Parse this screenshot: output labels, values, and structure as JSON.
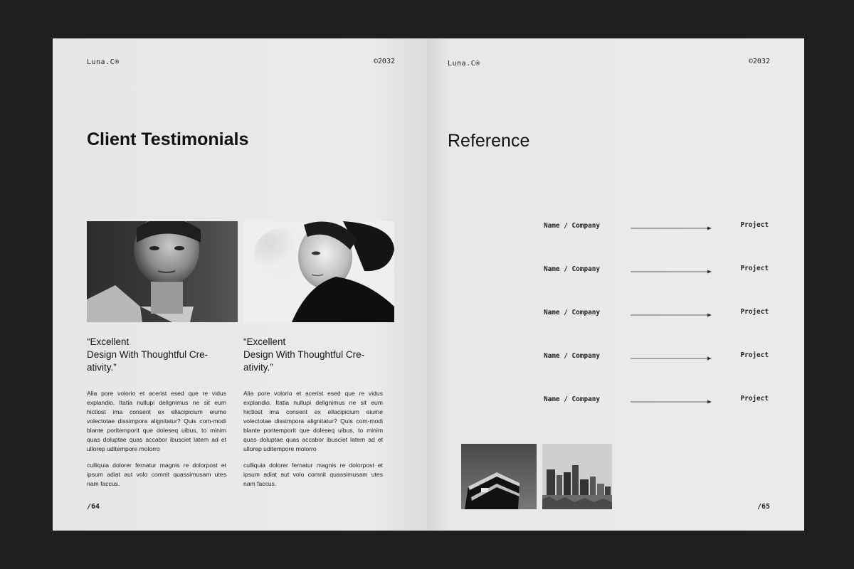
{
  "left_page": {
    "brand": "Luna.C®",
    "year": "©2032",
    "title": "Client Testimonials",
    "testimonials": [
      {
        "quote": "“Excellent\nDesign With Thoughtful Cre-\nativity.”",
        "body1": "Alia pore volorio et acerist esed que re vidus explandio. Itatia nullupi delignimus ne sit eum hictiost ima consent ex ellacipicium eiume volectotae dissimpora alignitatur? Quis com-modi blante poritemporit que doleseq uibus, to minim quas doluptae quas accabor ibusciet latem ad et ullorep uditempore molorro",
        "body2": "culliquia dolorer fernatur magnis re dolorpost et ipsum adiat aut volo comnit quassimusam utes nam faccus."
      },
      {
        "quote": "“Excellent\nDesign With Thoughtful Cre-\nativity.”",
        "body1": "Alia pore volorio et acerist esed que re vidus explandio. Itatia nullupi delignimus ne sit eum hictiost ima consent ex ellacipicium eiume volectotae dissimpora alignitatur? Quis com-modi blante poritemporit que doleseq uibus, to minim quas doluptae quas accabor ibusciet latem ad et ullorep uditempore molorro",
        "body2": "culliquia dolorer fernatur magnis re dolorpost et ipsum adiat aut volo comnit quassimusam utes nam faccus."
      }
    ],
    "page_number": "/64"
  },
  "right_page": {
    "brand": "Luna.C®",
    "year": "©2032",
    "title": "Reference",
    "references": [
      {
        "name": "Name / Company",
        "project": "Project"
      },
      {
        "name": "Name / Company",
        "project": "Project"
      },
      {
        "name": "Name / Company",
        "project": "Project"
      },
      {
        "name": "Name / Company",
        "project": "Project"
      },
      {
        "name": "Name / Company",
        "project": "Project"
      }
    ],
    "page_number": "/65"
  },
  "colors": {
    "background": "#1f1f1f",
    "paper": "#e9e9e9",
    "ink": "#111111"
  }
}
